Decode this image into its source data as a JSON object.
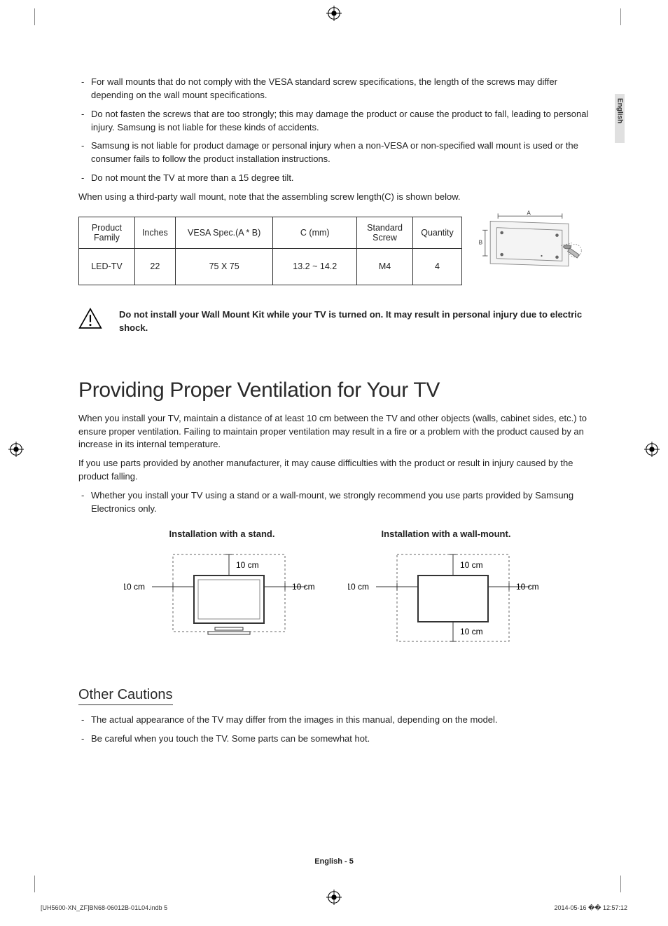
{
  "sideTab": "English",
  "bullets_top": [
    "For wall mounts that do not comply with the VESA standard screw specifications, the length of the screws may differ depending on the wall mount specifications.",
    "Do not fasten the screws that are too strongly; this may damage the product or cause the product to fall, leading to personal injury. Samsung is not liable for these kinds of accidents.",
    "Samsung is not liable for product damage or personal injury when a non-VESA or non-specified wall mount is used or the consumer fails to follow the product installation instructions.",
    "Do not mount the TV at more than a 15 degree tilt."
  ],
  "intro_line": "When using a third-party wall mount, note that the assembling screw length(C) is shown below.",
  "table": {
    "headers": [
      "Product Family",
      "Inches",
      "VESA Spec.(A * B)",
      "C (mm)",
      "Standard Screw",
      "Quantity"
    ],
    "row": [
      "LED-TV",
      "22",
      "75 X 75",
      "13.2 ~ 14.2",
      "M4",
      "4"
    ]
  },
  "vesa_labels": {
    "A": "A",
    "B": "B"
  },
  "warning": "Do not install your Wall Mount Kit while your TV is turned on. It may result in personal injury due to electric shock.",
  "h1": "Providing Proper Ventilation for Your TV",
  "ventilation_p1": "When you install your TV, maintain a distance of at least 10 cm between the TV and other objects (walls, cabinet sides, etc.) to ensure proper ventilation. Failing to maintain proper ventilation may result in a fire or a problem with the product caused by an increase in its internal temperature.",
  "ventilation_p2": "If you use parts provided by another manufacturer, it may cause difficulties with the product or result in injury caused by the product falling.",
  "ventilation_bullet": "Whether you install your TV using a stand or a wall-mount, we strongly recommend you use parts provided by Samsung Electronics only.",
  "stand_caption": "Installation with a stand.",
  "wall_caption": "Installation with a wall-mount.",
  "distance": "10 cm",
  "h2": "Other Cautions",
  "cautions": [
    "The actual appearance of the TV may differ from the images in this manual, depending on the model.",
    "Be careful when you touch the TV. Some parts can be somewhat hot."
  ],
  "footer_center": "English - 5",
  "footer_left": "[UH5600-XN_ZF]BN68-06012B-01L04.indb   5",
  "footer_right": "2014-05-16   �� 12:57:12"
}
